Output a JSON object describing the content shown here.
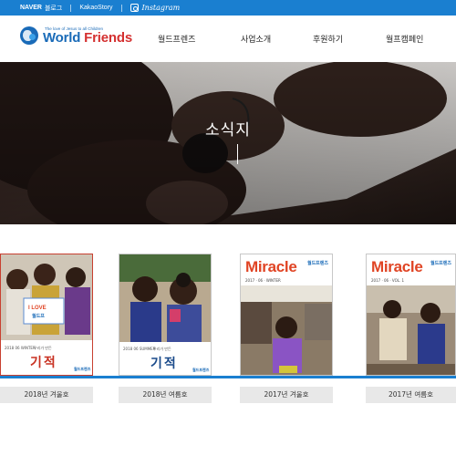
{
  "topbar": {
    "naver_brand": "NAVER",
    "naver_label": "블로그",
    "kakao_brand": "KakaoStory",
    "instagram_label": "Instagram",
    "bg_color": "#1a7fd0"
  },
  "header": {
    "logo_tagline": "The love of Jesus to all Children",
    "logo_name_a": "World",
    "logo_name_b": " Friends",
    "nav": [
      "월드프렌즈",
      "사업소개",
      "후원하기",
      "월프캠페인"
    ]
  },
  "hero": {
    "title": "소식지"
  },
  "newsletters": [
    {
      "caption": "2018년 겨울호",
      "sign_text": "I LOVE",
      "sign_sub": "월드프",
      "issue_small": "2018 06 WINTER",
      "heading_small": "우리가 만든",
      "heading_big": "기적",
      "footer_logo": "월드프렌즈"
    },
    {
      "caption": "2018년 여름호",
      "issue_small": "2018 06 SUMMER",
      "heading_small": "우리가 만든",
      "heading_big": "기적",
      "footer_logo": "월드프렌즈"
    },
    {
      "caption": "2017년 겨울호",
      "title": "Miracle",
      "brand": "월드프렌즈",
      "issue_small": "2017 · 06 · WINTER"
    },
    {
      "caption": "2017년 여름호",
      "title": "Miracle",
      "brand": "월드프렌즈",
      "issue_small": "2017 · 06 · VOL. 1"
    }
  ]
}
